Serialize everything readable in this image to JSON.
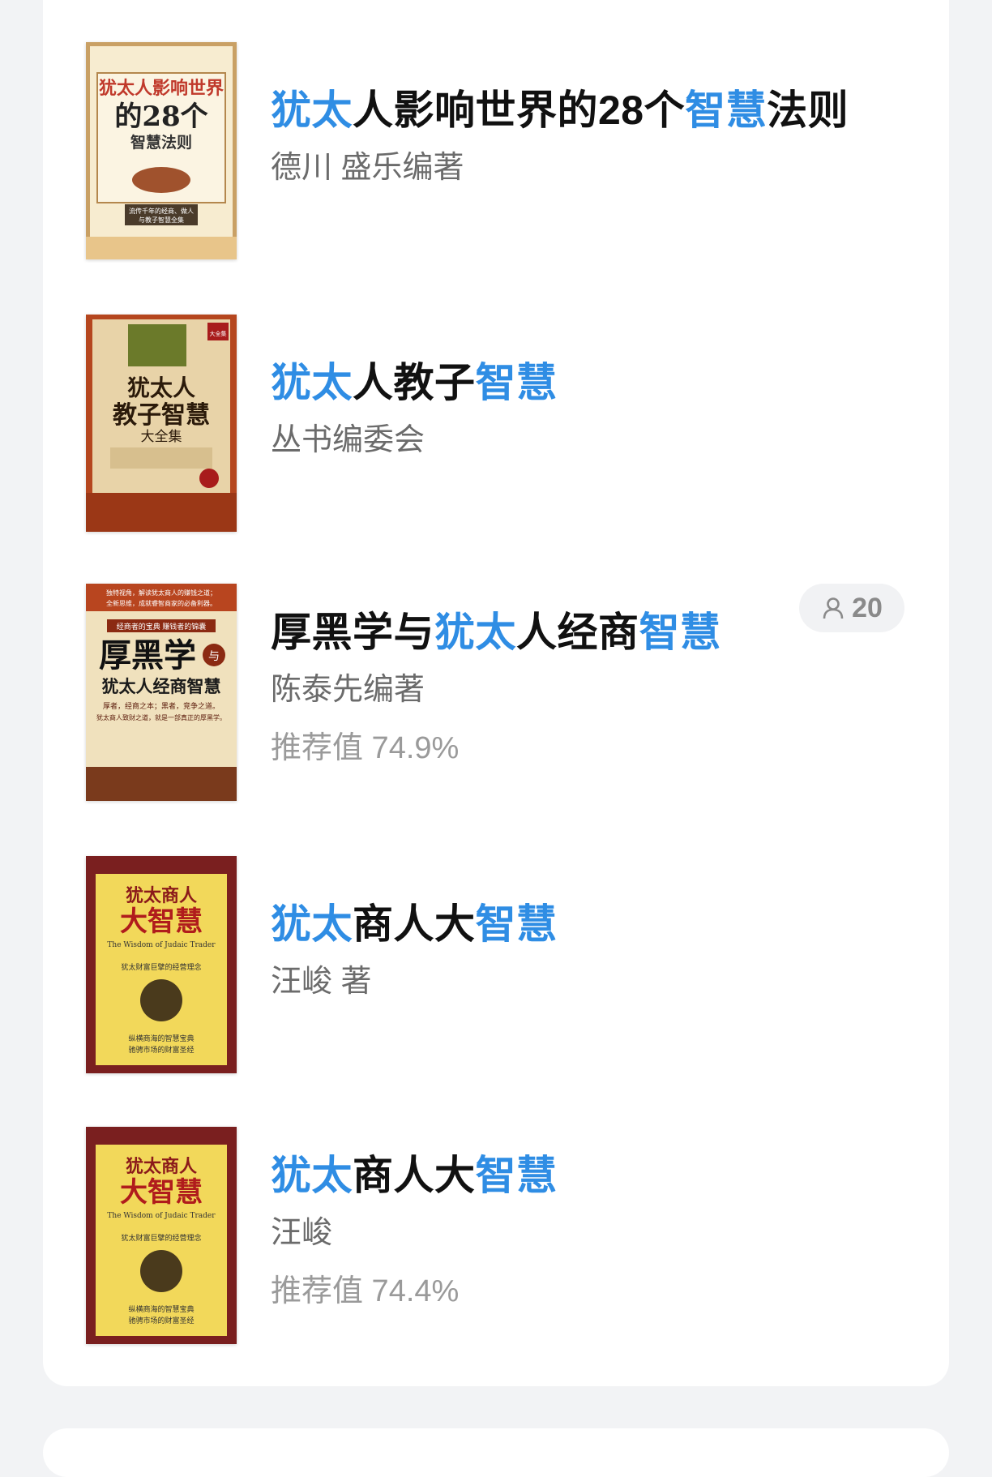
{
  "books": [
    {
      "title_parts": [
        {
          "text": "犹太",
          "hl": true
        },
        {
          "text": "人影响世界的28个",
          "hl": false
        },
        {
          "text": "智慧",
          "hl": true
        },
        {
          "text": "法则",
          "hl": false
        }
      ],
      "author": "德川 盛乐编著",
      "cover_text": [
        "犹太人影响世界",
        "的28个",
        "智慧法则",
        "流传千年的经商、做人",
        "与教子智慧全集"
      ]
    },
    {
      "title_parts": [
        {
          "text": "犹太",
          "hl": true
        },
        {
          "text": "人教子",
          "hl": false
        },
        {
          "text": "智慧",
          "hl": true
        }
      ],
      "author": "丛书编委会",
      "cover_text": [
        "犹太人",
        "教子智慧",
        "大全集",
        "大全集"
      ]
    },
    {
      "title_parts": [
        {
          "text": "厚黑学与",
          "hl": false
        },
        {
          "text": "犹太",
          "hl": true
        },
        {
          "text": "人经商",
          "hl": false
        },
        {
          "text": "智慧",
          "hl": true
        }
      ],
      "author": "陈泰先编著",
      "recommend": "推荐值 74.9%",
      "badge_count": "20",
      "cover_text": [
        "独特视角，解读犹太商人的赚钱之道；",
        "全新思维，成就睿智商家的必备利器。",
        "经商者的宝典 赚钱者的锦囊",
        "厚黑学",
        "与",
        "犹太人经商智慧",
        "厚者，经商之本；黑者，竞争之道。",
        "犹太商人致财之道，就是一部真正的厚黑学。"
      ]
    },
    {
      "title_parts": [
        {
          "text": "犹太",
          "hl": true
        },
        {
          "text": "商人大",
          "hl": false
        },
        {
          "text": "智慧",
          "hl": true
        }
      ],
      "author": "汪峻 著",
      "cover_text": [
        "犹太商人",
        "大智慧",
        "The Wisdom of Judaic Trader",
        "犹太财富巨擘的经营理念",
        "纵横商海的智慧宝典",
        "驰骋市场的财富圣经"
      ]
    },
    {
      "title_parts": [
        {
          "text": "犹太",
          "hl": true
        },
        {
          "text": "商人大",
          "hl": false
        },
        {
          "text": "智慧",
          "hl": true
        }
      ],
      "author": "汪峻",
      "recommend": "推荐值 74.4%",
      "cover_text": [
        "犹太商人",
        "大智慧",
        "The Wisdom of Judaic Trader",
        "犹太财富巨擘的经营理念",
        "纵横商海的智慧宝典",
        "驰骋市场的财富圣经"
      ]
    }
  ],
  "colors": {
    "highlight": "#2f8de4",
    "title": "#111111",
    "author": "#6b6b6b",
    "recommend": "#9a9a9a"
  },
  "badge_icon": "person-icon"
}
